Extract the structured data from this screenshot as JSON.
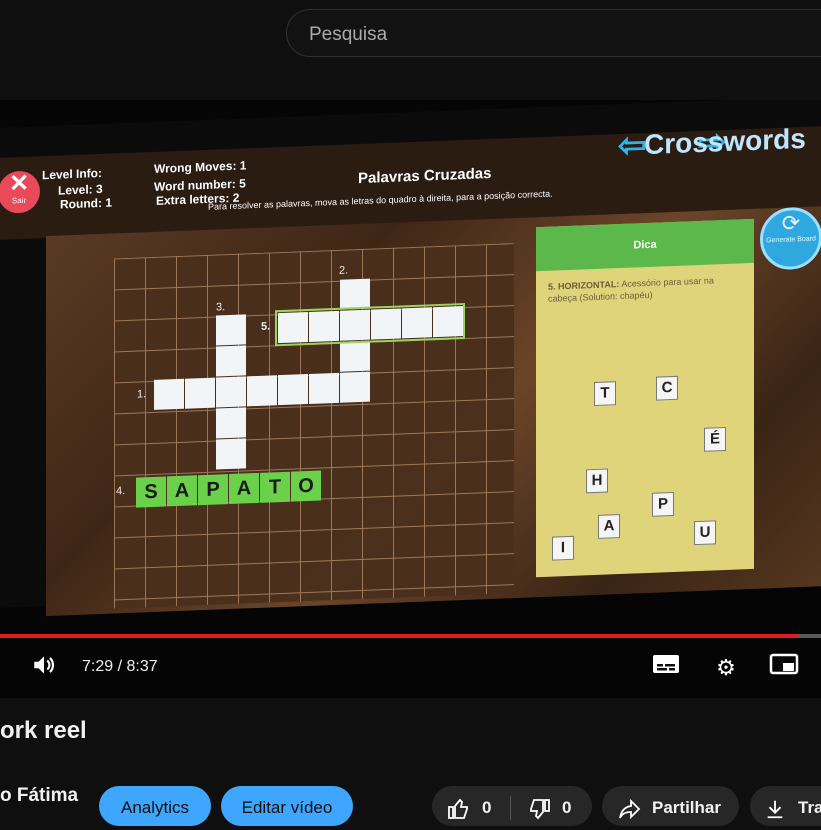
{
  "search": {
    "placeholder": "Pesquisa"
  },
  "game": {
    "title": "Crosswords",
    "subtitle": "Palavras Cruzadas",
    "instructions": "Para resolver as palavras, mova as letras do quadro à direita, para a posição correcta.",
    "exit_label": "Sair",
    "regen_label": "Generate Board",
    "info": {
      "level_info": "Level Info:",
      "level": "Level: 3",
      "round": "Round: 1",
      "wrong_moves": "Wrong Moves: 1",
      "word_number": "Word number: 5",
      "extra_letters": "Extra letters: 2"
    },
    "numbers": {
      "n1": "1.",
      "n2": "2.",
      "n3": "3.",
      "n4": "4.",
      "n5": "5."
    },
    "solved_word": [
      "S",
      "A",
      "P",
      "A",
      "T",
      "O"
    ],
    "hint": {
      "header": "Dica",
      "clue_label": "5. HORIZONTAL:",
      "clue_text": "Acessório para usar na cabeça (Solution: chapéu)"
    },
    "tiles": [
      "T",
      "C",
      "É",
      "H",
      "P",
      "A",
      "U",
      "I"
    ]
  },
  "player": {
    "time": "7:29 / 8:37",
    "progress_fraction": 0.972,
    "colors": {
      "progress": "#e21b1b",
      "accent": "#3ea6ff"
    }
  },
  "video": {
    "title": "ork reel"
  },
  "channel": {
    "name": "o Fátima"
  },
  "actions": {
    "analytics": "Analytics",
    "edit": "Editar vídeo",
    "likes": "0",
    "dislikes": "0",
    "share": "Partilhar",
    "download": "Tra"
  }
}
